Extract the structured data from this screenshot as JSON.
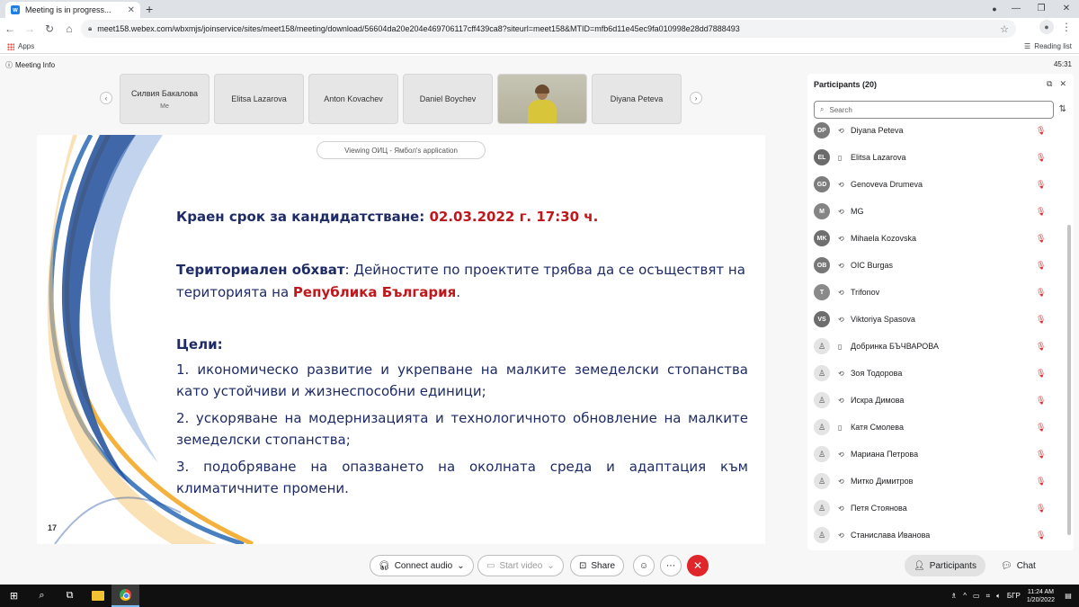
{
  "browser": {
    "tab_title": "Meeting is in progress...",
    "tab_favicon": "webex-icon",
    "url": "meet158.webex.com/wbxmjs/joinservice/sites/meet158/meeting/download/56604da20e204e469706117cff439ca8?siteurl=meet158&MTID=mfb6d11e45ec9fa010998e28dd7888493",
    "bookmarks_apps": "Apps",
    "reading_list": "Reading list"
  },
  "meeting": {
    "info_label": "Meeting Info",
    "timer": "45:31",
    "viewing_label": "Viewing ОИЦ - Ямбол's application"
  },
  "video_strip": [
    {
      "name": "Силвия Бакалова",
      "sub": "Me"
    },
    {
      "name": "Elitsa Lazarova"
    },
    {
      "name": "Anton Kovachev"
    },
    {
      "name": "Daniel Boychev"
    },
    {
      "name": ""
    },
    {
      "name": "Diyana Peteva"
    }
  ],
  "slide": {
    "deadline_label": "Краен срок за кандидатстване: ",
    "deadline_value": "02.03.2022 г. 17:30 ч.",
    "territory_label": "Териториален обхват",
    "territory_text": ": Дейностите по проектите трябва да се осъществят на територията на ",
    "territory_country": "Република България",
    "territory_end": ".",
    "goals_title": "Цели:",
    "goal_1": "1. икономическо развитие и укрепване на малките земеделски стопанства като устойчиви и жизнеспособни единици;",
    "goal_2": "2. ускоряване на модернизацията и технологичното обновление на малките земеделски стопанства;",
    "goal_3": "3. подобряване на опазването на околната среда и адаптация към климатичните промени.",
    "page_number": "17",
    "colors": {
      "text": "#1e2b66",
      "accent_red": "#c0171c"
    }
  },
  "participants": {
    "title": "Participants (20)",
    "search_placeholder": "Search",
    "list": [
      {
        "initials": "DP",
        "name": "Diyana Peteva",
        "device": "sync-icon"
      },
      {
        "initials": "EL",
        "name": "Elitsa Lazarova",
        "device": "phone-icon"
      },
      {
        "initials": "GD",
        "name": "Genoveva Drumeva",
        "device": "sync-icon"
      },
      {
        "initials": "M",
        "name": "MG",
        "device": "sync-icon"
      },
      {
        "initials": "MK",
        "name": "Mihaela Kozovska",
        "device": "sync-icon"
      },
      {
        "initials": "OB",
        "name": "OIC Burgas",
        "device": "sync-icon"
      },
      {
        "initials": "T",
        "name": "Trifonov",
        "device": "sync-icon"
      },
      {
        "initials": "VS",
        "name": "Viktoriya Spasova",
        "device": "sync-icon"
      },
      {
        "initials": "",
        "name": "Добринка БЪЧВАРОВА",
        "device": "phone-icon"
      },
      {
        "initials": "",
        "name": "Зоя Тодорова",
        "device": "sync-icon"
      },
      {
        "initials": "",
        "name": "Искра Димова",
        "device": "sync-icon"
      },
      {
        "initials": "",
        "name": "Катя Смолева",
        "device": "phone-icon"
      },
      {
        "initials": "",
        "name": "Мариана Петрова",
        "device": "sync-icon"
      },
      {
        "initials": "",
        "name": "Митко Димитров",
        "device": "sync-icon"
      },
      {
        "initials": "",
        "name": "Петя Стоянова",
        "device": "sync-icon"
      },
      {
        "initials": "",
        "name": "Станислава Иванова",
        "device": "sync-icon"
      }
    ]
  },
  "controls": {
    "audio": "Connect audio",
    "video": "Start video",
    "share": "Share",
    "participants": "Participants",
    "chat": "Chat",
    "leave_color": "#e0262b"
  },
  "taskbar": {
    "language": "БГР",
    "time": "11:24 AM",
    "date": "1/20/2022"
  }
}
